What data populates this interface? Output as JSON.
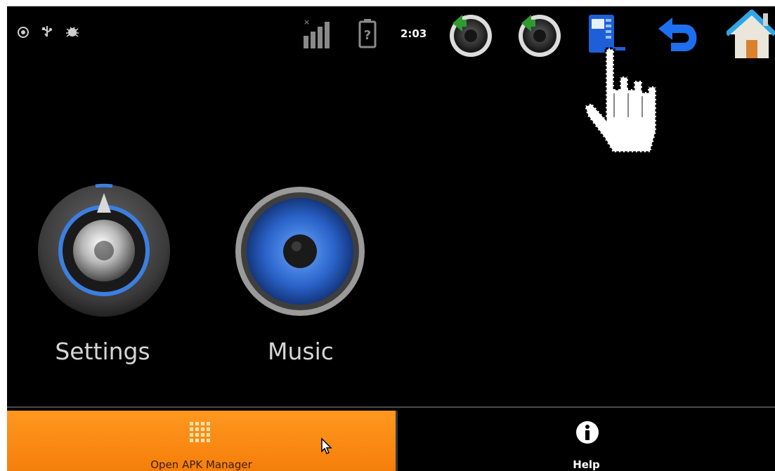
{
  "status_bar": {
    "clock": "2:03",
    "notification_icons": [
      "settings-notification-icon",
      "usb-icon",
      "debug-icon"
    ],
    "system_icons": [
      "signal-icon",
      "battery-unknown-icon"
    ],
    "soft_buttons": [
      "volume-down-button",
      "volume-up-button",
      "menu-button",
      "back-button",
      "home-button"
    ]
  },
  "launcher": {
    "apps": [
      {
        "label": "Settings",
        "icon": "settings-knob-icon"
      },
      {
        "label": "Music",
        "icon": "speaker-icon"
      }
    ]
  },
  "bottom_bar": {
    "primary_label": "Open APK Manager",
    "primary_icon": "grid-icon",
    "secondary_label": "Help",
    "secondary_icon": "info-icon"
  },
  "colors": {
    "background": "#000000",
    "accent_orange": "#f98d16",
    "text_light": "#d6d6d6",
    "soft_key_blue": "#1e5fd8"
  }
}
